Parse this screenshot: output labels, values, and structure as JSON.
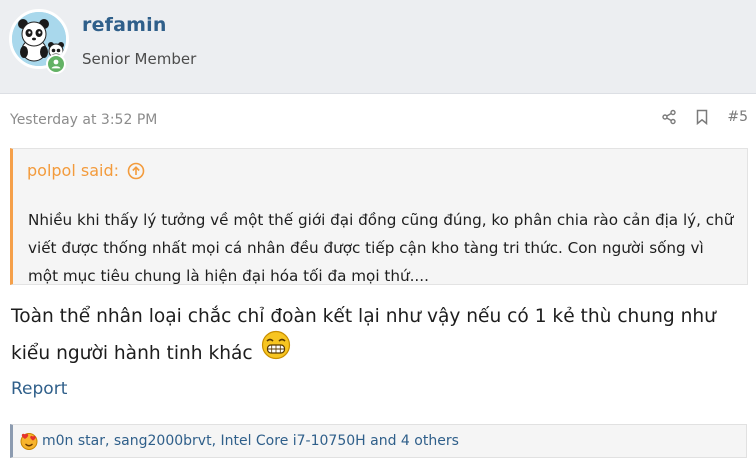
{
  "user": {
    "name": "refamin",
    "title": "Senior Member",
    "avatar_icon": "panda-avatar-icon",
    "status_icon": "online-status-icon"
  },
  "post": {
    "date": "Yesterday at 3:52 PM",
    "number": "#5",
    "actions": [
      "share-icon",
      "bookmark-icon"
    ]
  },
  "quote": {
    "author_line": "polpol said:",
    "text": "Nhiều khi thấy lý tưởng về một thế giới đại đồng cũng đúng, ko phân chia rào cản địa lý, chữ viết được thống nhất mọi cá nhân đều được tiếp cận kho tàng tri thức. Con người sống vì một mục tiêu chung là hiện đại hóa tối đa mọi thứ...."
  },
  "message": {
    "text": "Toàn thể nhân loại chắc chỉ đoàn kết lại như vậy nếu có 1 kẻ thù chung như kiểu người hành tinh khác",
    "emoji_icon": "grinning-smiley-icon"
  },
  "links": {
    "report": "Report"
  },
  "reactions": {
    "summary": "m0n star, sang2000brvt, Intel Core i7-10750H and 4 others",
    "icon": "love-reaction-icon"
  },
  "colors": {
    "link": "#2f5f8a",
    "quote_accent": "#f39b3c",
    "online": "#63b265",
    "header_bg": "#eceef1"
  }
}
